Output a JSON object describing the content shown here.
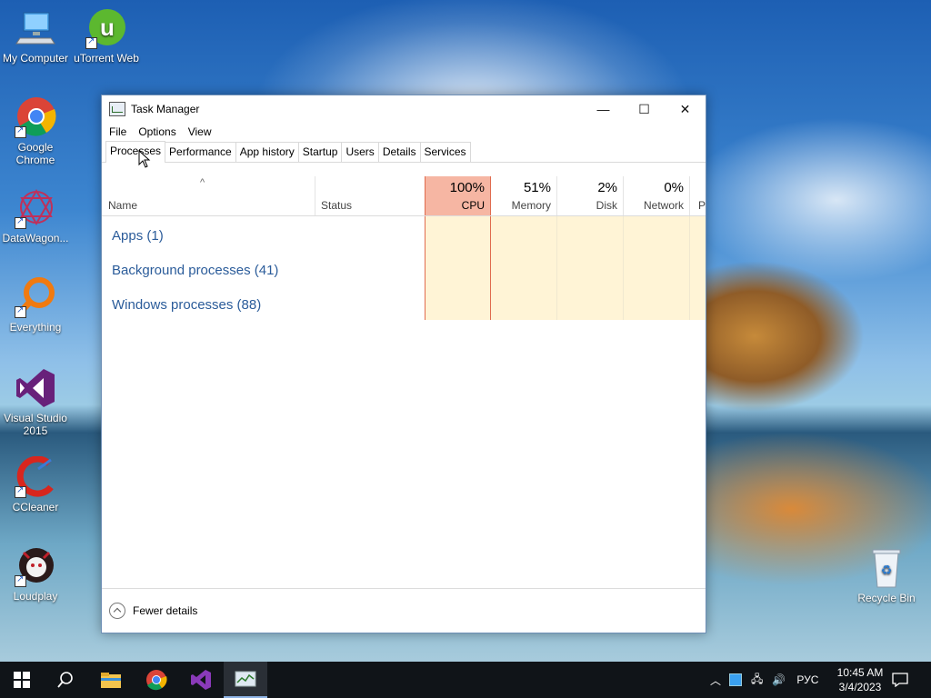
{
  "desktop": {
    "icons": [
      {
        "label": "My Computer"
      },
      {
        "label": "uTorrent Web"
      },
      {
        "label": "Google Chrome"
      },
      {
        "label": "DataWagon..."
      },
      {
        "label": "Everything"
      },
      {
        "label": "Visual Studio 2015"
      },
      {
        "label": "CCleaner"
      },
      {
        "label": "Loudplay"
      },
      {
        "label": "Recycle Bin"
      }
    ]
  },
  "window": {
    "title": "Task Manager",
    "controls": {
      "minimize": "—",
      "maximize": "☐",
      "close": "✕"
    },
    "menu": [
      "File",
      "Options",
      "View"
    ],
    "tabs": [
      "Processes",
      "Performance",
      "App history",
      "Startup",
      "Users",
      "Details",
      "Services"
    ],
    "active_tab": "Processes",
    "columns": {
      "name": "Name",
      "status": "Status",
      "cpu": {
        "pct": "100%",
        "label": "CPU"
      },
      "memory": {
        "pct": "51%",
        "label": "Memory"
      },
      "disk": {
        "pct": "2%",
        "label": "Disk"
      },
      "network": {
        "pct": "0%",
        "label": "Network"
      },
      "power": {
        "label": "P"
      }
    },
    "groups": [
      "Apps (1)",
      "Background processes (41)",
      "Windows processes (88)"
    ],
    "footer": {
      "label": "Fewer details"
    }
  },
  "taskbar": {
    "tray_language": "РУС",
    "time": "10:45 AM",
    "date": "3/4/2023"
  },
  "colors": {
    "cpu_header": "#f6b6a3",
    "cpu_border": "#e06b4e",
    "heat_band": "#fff4d6",
    "group_text": "#2b5c9a",
    "taskbar": "#101418"
  }
}
